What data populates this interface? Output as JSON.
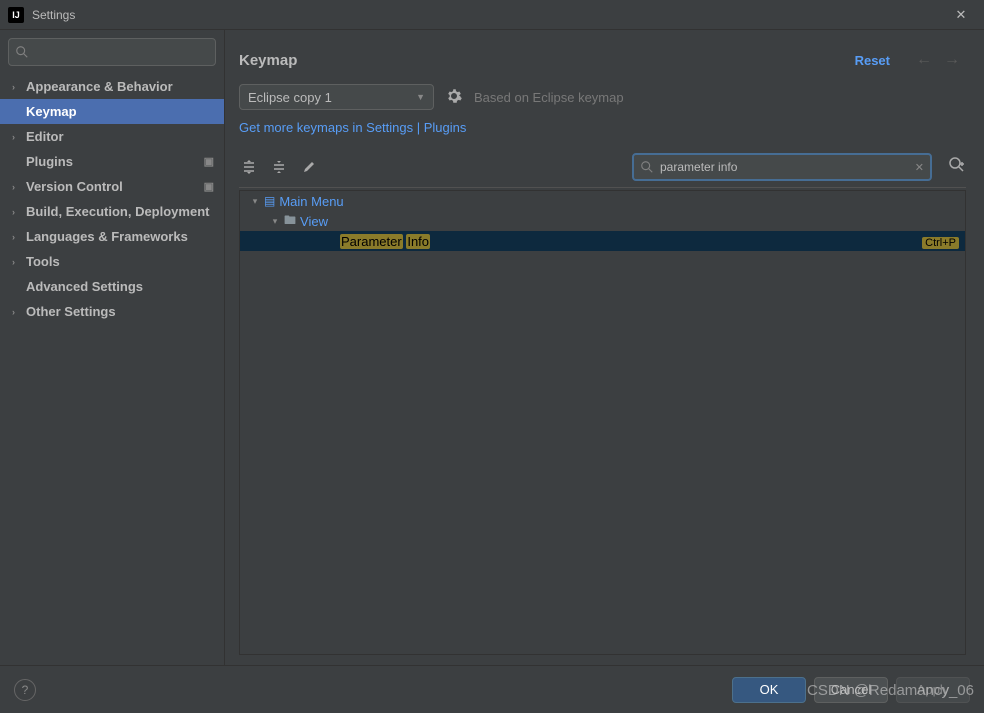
{
  "window": {
    "title": "Settings"
  },
  "sidebar": {
    "search_placeholder": "",
    "items": [
      {
        "label": "Appearance & Behavior",
        "expandable": true,
        "selected": false,
        "badge": false
      },
      {
        "label": "Keymap",
        "expandable": false,
        "selected": true,
        "badge": false
      },
      {
        "label": "Editor",
        "expandable": true,
        "selected": false,
        "badge": false
      },
      {
        "label": "Plugins",
        "expandable": false,
        "selected": false,
        "badge": true
      },
      {
        "label": "Version Control",
        "expandable": true,
        "selected": false,
        "badge": true
      },
      {
        "label": "Build, Execution, Deployment",
        "expandable": true,
        "selected": false,
        "badge": false
      },
      {
        "label": "Languages & Frameworks",
        "expandable": true,
        "selected": false,
        "badge": false
      },
      {
        "label": "Tools",
        "expandable": true,
        "selected": false,
        "badge": false
      },
      {
        "label": "Advanced Settings",
        "expandable": false,
        "selected": false,
        "badge": false
      },
      {
        "label": "Other Settings",
        "expandable": true,
        "selected": false,
        "badge": false
      }
    ]
  },
  "main": {
    "title": "Keymap",
    "reset": "Reset",
    "keymap_selected": "Eclipse copy 1",
    "based_on": "Based on Eclipse keymap",
    "more_link": "Get more keymaps in Settings | Plugins",
    "search_value": "parameter info",
    "results": {
      "main_menu": "Main Menu",
      "view": "View",
      "action_hl1": "Parameter",
      "action_hl2": "Info",
      "shortcut": "Ctrl+P"
    }
  },
  "footer": {
    "ok": "OK",
    "cancel": "Cancel",
    "apply": "Apply"
  },
  "watermark": "CSDN @Redamancy_06"
}
